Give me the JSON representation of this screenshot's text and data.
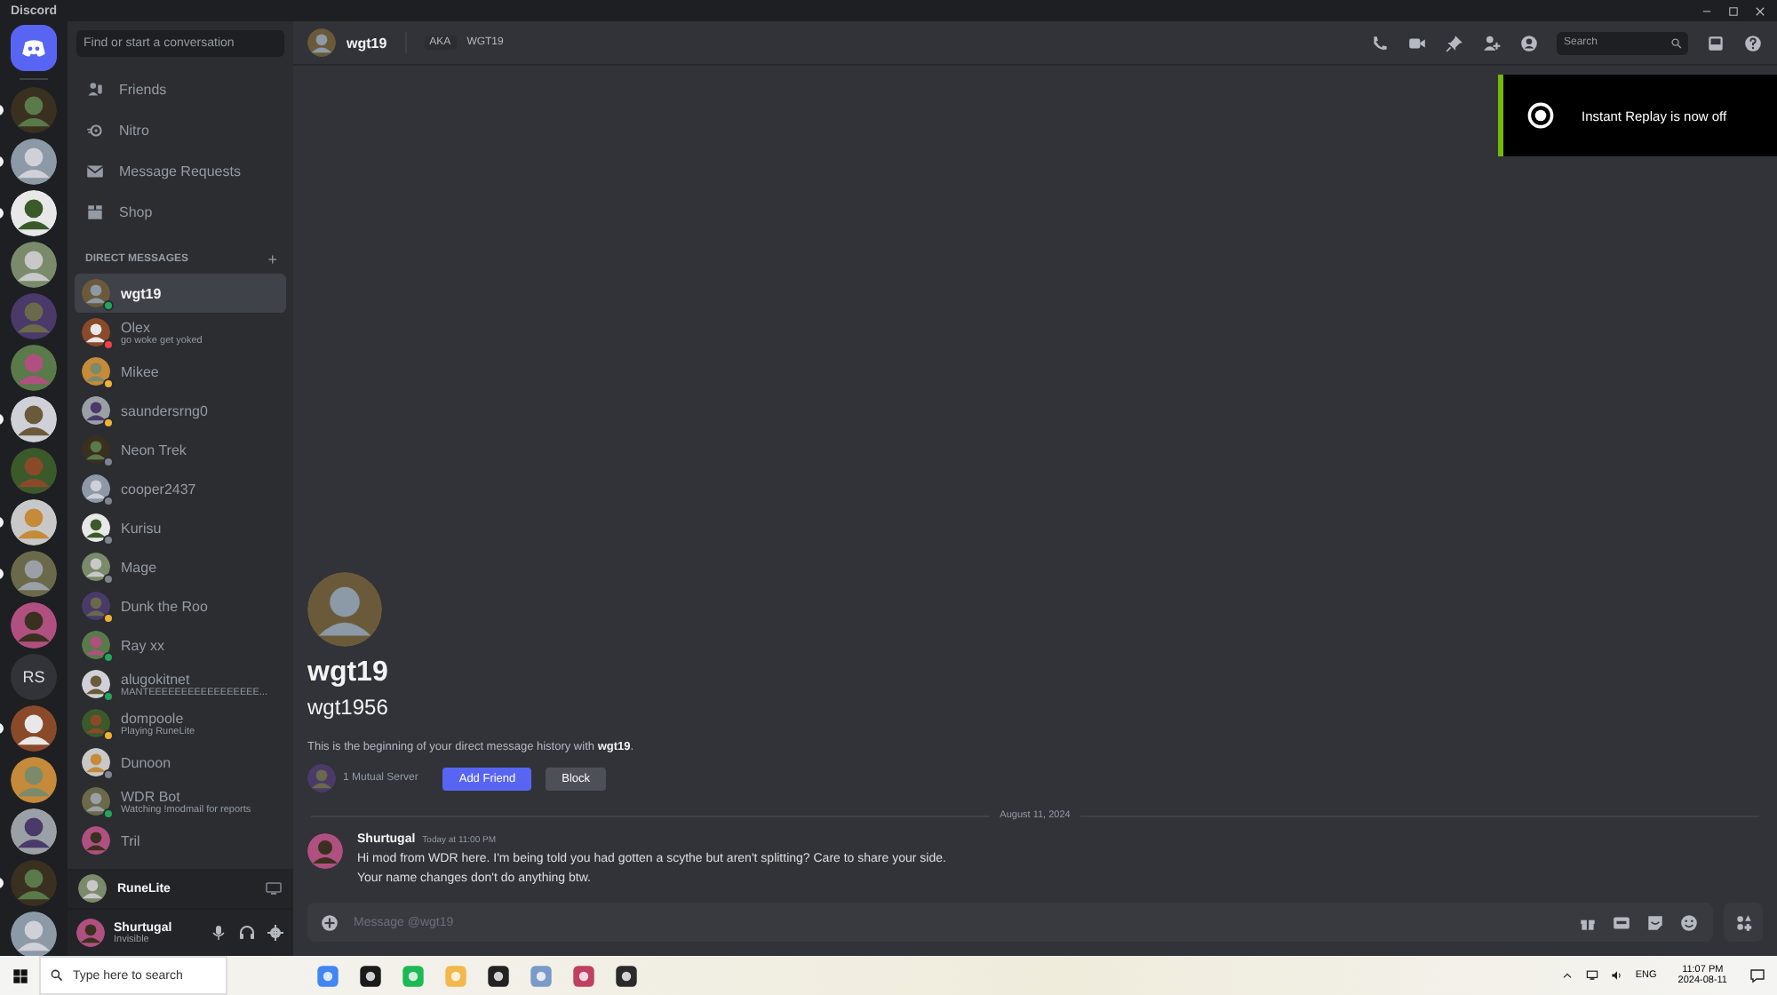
{
  "window": {
    "title": "Discord"
  },
  "servers": [
    {
      "kind": "home",
      "unread": false
    },
    {
      "kind": "picture",
      "unread": true
    },
    {
      "kind": "picture",
      "unread": true
    },
    {
      "kind": "picture",
      "unread": true
    },
    {
      "kind": "picture",
      "unread": false
    },
    {
      "kind": "picture",
      "unread": false
    },
    {
      "kind": "picture",
      "unread": false
    },
    {
      "kind": "picture",
      "unread": true
    },
    {
      "kind": "picture",
      "unread": false
    },
    {
      "kind": "picture",
      "unread": true
    },
    {
      "kind": "picture",
      "unread": true
    },
    {
      "kind": "picture",
      "unread": false
    },
    {
      "kind": "text",
      "label": "RS",
      "unread": false
    },
    {
      "kind": "picture",
      "unread": true
    },
    {
      "kind": "picture",
      "unread": false
    },
    {
      "kind": "picture",
      "unread": false
    },
    {
      "kind": "picture",
      "unread": true
    },
    {
      "kind": "picture",
      "unread": false
    }
  ],
  "sidebar": {
    "search": {
      "placeholder": "Find or start a conversation"
    },
    "nav": [
      {
        "kind": "friends",
        "label": "Friends"
      },
      {
        "kind": "nitro",
        "label": "Nitro"
      },
      {
        "kind": "requests",
        "label": "Message Requests"
      },
      {
        "kind": "shop",
        "label": "Shop"
      }
    ],
    "section_title": "DIRECT MESSAGES",
    "add": "+",
    "dms": [
      {
        "name": "wgt19",
        "color": "#23a55a",
        "selected": true
      },
      {
        "name": "Olex",
        "subtitle": "go woke get yoked",
        "color": "#f23f43",
        "selected": false
      },
      {
        "name": "Mikee",
        "color": "#f0b232",
        "selected": false
      },
      {
        "name": "saundersrng0",
        "color": "#f0b232",
        "selected": false
      },
      {
        "name": "Neon Trek",
        "color": "#80848e",
        "selected": false
      },
      {
        "name": "cooper2437",
        "color": "#80848e",
        "selected": false
      },
      {
        "name": "Kurisu",
        "color": "#80848e",
        "selected": false
      },
      {
        "name": "Mage",
        "color": "#80848e",
        "selected": false
      },
      {
        "name": "Dunk the Roo",
        "color": "#f0b232",
        "selected": false
      },
      {
        "name": "Ray xx",
        "color": "#23a55a",
        "selected": false
      },
      {
        "name": "alugokitnet",
        "subtitle": "MANTEEEEEEEEEEEEEEEEE...",
        "color": "#23a55a",
        "selected": false
      },
      {
        "name": "dompoole",
        "subtitle": "Playing RuneLite",
        "color": "#f0b232",
        "selected": false
      },
      {
        "name": "Dunoon",
        "color": "#80848e",
        "selected": false
      },
      {
        "name": "WDR Bot",
        "subtitle": "Watching !modmail for reports",
        "color": "#23a55a",
        "selected": false
      },
      {
        "name": "Tril",
        "selected": false
      }
    ],
    "activity": {
      "name": "RuneLite"
    },
    "user": {
      "name": "Shurtugal",
      "status_text": "Invisible"
    }
  },
  "header": {
    "name": "wgt19",
    "aka": "AKA",
    "alias": "WGT19",
    "search": {
      "placeholder": "Search"
    }
  },
  "toast": {
    "text": "Instant Replay is now off"
  },
  "intro": {
    "name": "wgt19",
    "username": "wgt1956",
    "text": "This is the beginning of your direct message history with **wgt19**.",
    "mutual": "1 Mutual Server",
    "buttons": [
      {
        "kind": "primary",
        "label": "Add Friend"
      },
      {
        "kind": "secondary",
        "label": "Block"
      }
    ]
  },
  "divider": "August 11, 2024",
  "messages": [
    {
      "author": "Shurtugal",
      "time": "Today at 11:00 PM",
      "lines": [
        "Hi mod from WDR here. I'm being told you had gotten a scythe but aren't splitting? Care to share your side.",
        "Your name changes don't do anything btw."
      ]
    }
  ],
  "composer": {
    "placeholder": "Message @wgt19"
  },
  "taskbar": {
    "search": {
      "placeholder": "Type here to search"
    },
    "apps": [
      {
        "color": "#4285f4"
      },
      {
        "color": "#1a1a1a"
      },
      {
        "color": "#1db954"
      },
      {
        "color": "#f2b84b"
      },
      {
        "color": "#222222"
      },
      {
        "color": "#7a9ac8"
      },
      {
        "color": "#c04060"
      },
      {
        "color": "#2a2a2a"
      }
    ],
    "language": "ENG",
    "time": "11:07 PM",
    "date": "2024-08-11"
  }
}
